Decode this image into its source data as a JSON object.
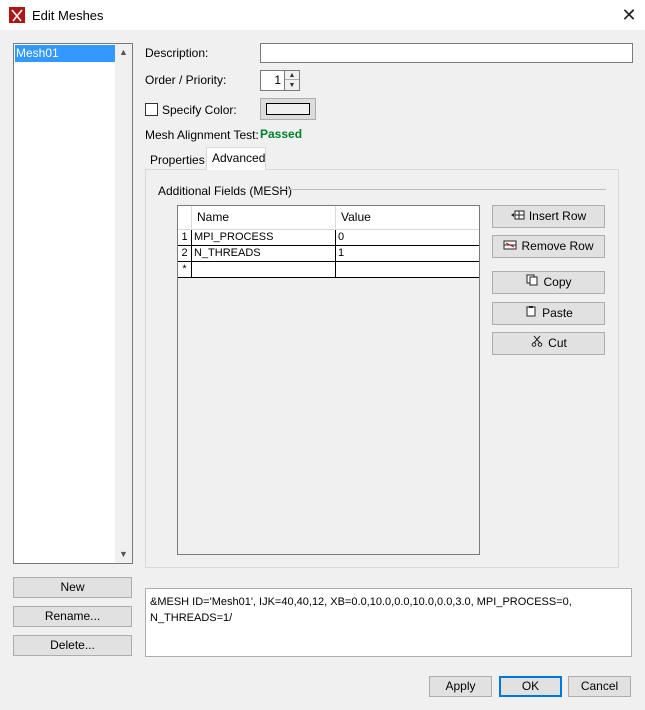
{
  "window": {
    "title": "Edit Meshes",
    "close_glyph": "✕"
  },
  "mesh_list": {
    "items": [
      "Mesh01"
    ],
    "selected_index": 0
  },
  "left_buttons": {
    "new": "New",
    "rename": "Rename...",
    "delete": "Delete..."
  },
  "form": {
    "description_label": "Description:",
    "description_value": "",
    "order_label": "Order / Priority:",
    "order_value": "1",
    "specify_color_label": "Specify Color:",
    "specify_color_checked": false,
    "alignment_label": "Mesh Alignment Test:",
    "alignment_value": "Passed",
    "alignment_color": "#00802b"
  },
  "tabs": [
    {
      "label": "Properties",
      "active": false
    },
    {
      "label": "Advanced",
      "active": true
    }
  ],
  "advanced": {
    "group_label": "Additional Fields (MESH)",
    "table": {
      "columns": [
        "Name",
        "Value"
      ],
      "rows": [
        {
          "num": "1",
          "name": "MPI_PROCESS",
          "value": "0"
        },
        {
          "num": "2",
          "name": "N_THREADS",
          "value": "1"
        },
        {
          "num": "*",
          "name": "",
          "value": ""
        }
      ]
    },
    "buttons": {
      "insert_row": "Insert Row",
      "remove_row": "Remove Row",
      "copy": "Copy",
      "paste": "Paste",
      "cut": "Cut"
    }
  },
  "output_text": "&MESH ID='Mesh01', IJK=40,40,12, XB=0.0,10.0,0.0,10.0,0.0,3.0, MPI_PROCESS=0,\nN_THREADS=1/",
  "footer": {
    "apply": "Apply",
    "ok": "OK",
    "cancel": "Cancel"
  },
  "colors": {
    "selection": "#3399ff",
    "app_icon": "#b01414",
    "default_button_border": "#0078d7"
  },
  "icons": {
    "insert_row": "insert-row-icon",
    "remove_row": "remove-row-icon",
    "copy": "copy-icon",
    "paste": "paste-icon",
    "cut": "scissors-icon"
  }
}
